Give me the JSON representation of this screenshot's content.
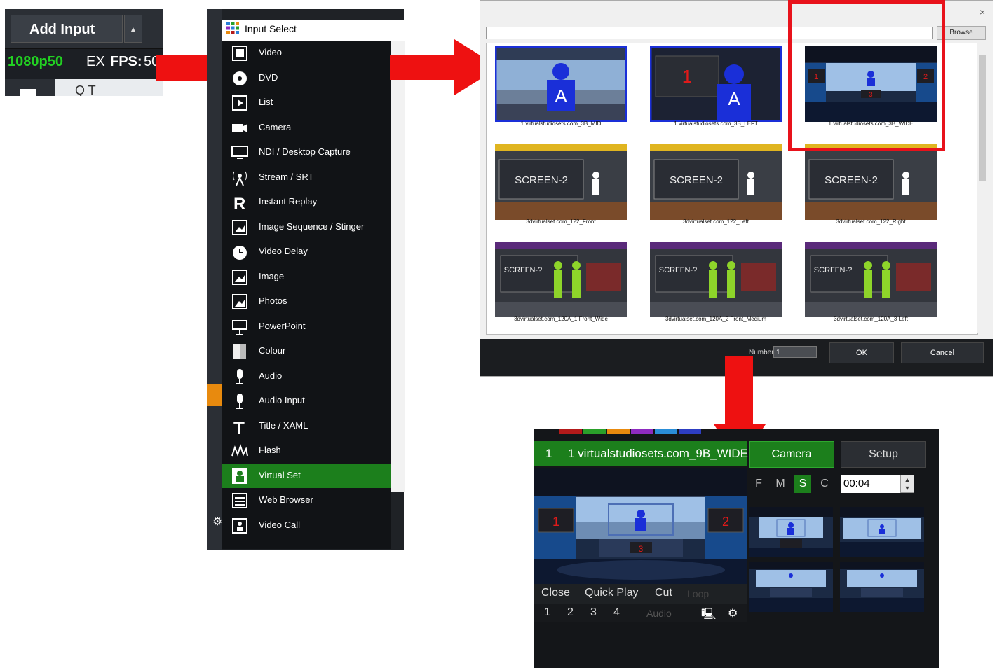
{
  "panel_add_input": {
    "add_input_label": "Add Input",
    "dropdown_glyph": "▲",
    "resolution": "1080p50",
    "ex_label": "EX",
    "fps_label": "FPS:",
    "fps_value": "50",
    "search_glyph": "Q T"
  },
  "input_select": {
    "title": "Input Select",
    "items": [
      {
        "label": "Video",
        "icon": "video-icon"
      },
      {
        "label": "DVD",
        "icon": "dvd-icon"
      },
      {
        "label": "List",
        "icon": "list-icon"
      },
      {
        "label": "Camera",
        "icon": "camera-icon"
      },
      {
        "label": "NDI / Desktop Capture",
        "icon": "monitor-icon"
      },
      {
        "label": "Stream / SRT",
        "icon": "antenna-icon"
      },
      {
        "label": "Instant Replay",
        "icon": "replay-icon"
      },
      {
        "label": "Image Sequence / Stinger",
        "icon": "image-sequence-icon"
      },
      {
        "label": "Video Delay",
        "icon": "clock-icon"
      },
      {
        "label": "Image",
        "icon": "image-icon"
      },
      {
        "label": "Photos",
        "icon": "photos-icon"
      },
      {
        "label": "PowerPoint",
        "icon": "presentation-icon"
      },
      {
        "label": "Colour",
        "icon": "colour-icon"
      },
      {
        "label": "Audio",
        "icon": "microphone-icon"
      },
      {
        "label": "Audio Input",
        "icon": "microphone-icon"
      },
      {
        "label": "Title / XAML",
        "icon": "title-icon"
      },
      {
        "label": "Flash",
        "icon": "flash-icon"
      },
      {
        "label": "Virtual Set",
        "icon": "person-icon",
        "selected": true
      },
      {
        "label": "Web Browser",
        "icon": "browser-icon"
      },
      {
        "label": "Video Call",
        "icon": "video-call-icon"
      }
    ],
    "colors": {
      "selected": "#1c7f1c"
    }
  },
  "virtual_set_dialog": {
    "browse_label": "Browse",
    "close_glyph": "×",
    "thumbnails": [
      {
        "caption": "1 virtualstudiosets.com_3B_MID",
        "kind": "person-a-window"
      },
      {
        "caption": "1 virtualstudiosets.com_3B_LEFT",
        "kind": "person-a-screen"
      },
      {
        "caption": "1 virtualstudiosets.com_3B_WIDE",
        "kind": "studio-wide"
      },
      {
        "caption": "3dvirtualset.com_122_Front",
        "kind": "screen2"
      },
      {
        "caption": "3dvirtualset.com_122_Left",
        "kind": "screen2"
      },
      {
        "caption": "3dvirtualset.com_122_Right",
        "kind": "screen2"
      },
      {
        "caption": "3dvirtualset.com_120A_1 Front_Wide",
        "kind": "green-screen"
      },
      {
        "caption": "3dvirtualset.com_120A_2 Front_Medium",
        "kind": "green-screen"
      },
      {
        "caption": "3dvirtualset.com_120A_3 Left",
        "kind": "green-screen"
      }
    ],
    "thumb_texts": {
      "one": "1",
      "two": "2",
      "three": "3",
      "a": "A",
      "screen2": "SCREEN-2",
      "screen_alt": "SCRFFN-?"
    },
    "number_label": "Number",
    "number_value": "1",
    "ok_label": "OK",
    "cancel_label": "Cancel"
  },
  "input_panel": {
    "number": "1",
    "title": "1 virtualstudiosets.com_9B_WIDE",
    "camera_label": "Camera",
    "setup_label": "Setup",
    "modes": [
      "F",
      "M",
      "S",
      "C"
    ],
    "active_mode": "S",
    "time_value": "00:04",
    "controls": {
      "close": "Close",
      "quick_play": "Quick Play",
      "cut": "Cut",
      "loop": "Loop"
    },
    "numbers": [
      "1",
      "2",
      "3",
      "4"
    ],
    "audio_label": "Audio",
    "preview_texts": {
      "left": "1",
      "right": "2",
      "desk": "3"
    },
    "tab_colors": [
      "#b31a1a",
      "#2aa02a",
      "#e88a0e",
      "#8e2bc0",
      "#2a8ed8",
      "#2d3ec2"
    ]
  }
}
